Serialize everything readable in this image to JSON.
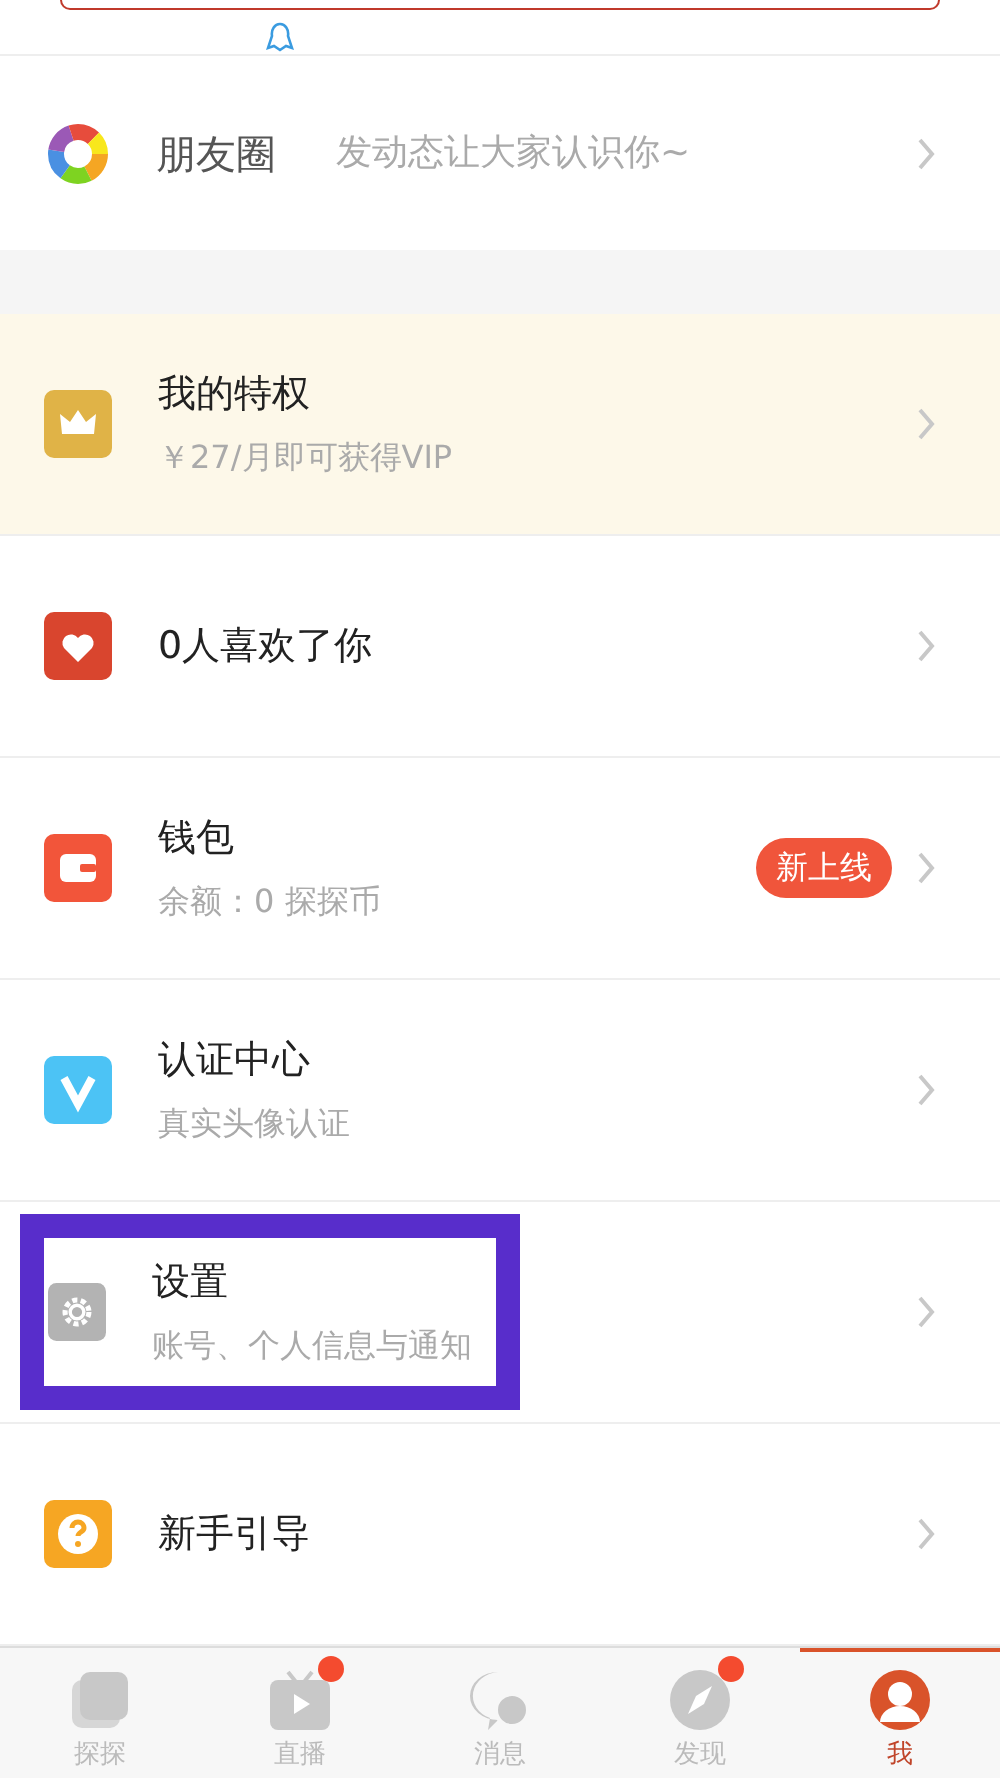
{
  "moments": {
    "title": "朋友圈",
    "hint": "发动态让大家认识你~"
  },
  "items": [
    {
      "kind": "promo",
      "title": "我的特权",
      "subtitle": "￥27/月即可获得VIP",
      "annotated": false
    },
    {
      "kind": "normal",
      "title": "0人喜欢了你",
      "annotated": false
    },
    {
      "kind": "normal",
      "title": "钱包",
      "subtitle": "余额：0 探探币",
      "badge": "新上线",
      "annotated": false
    },
    {
      "kind": "normal",
      "title": "认证中心",
      "subtitle": "真实头像认证",
      "annotated": false
    },
    {
      "kind": "normal",
      "title": "设置",
      "subtitle": "账号、个人信息与通知",
      "annotated": true
    },
    {
      "kind": "normal",
      "title": "新手引导",
      "annotated": false
    }
  ],
  "tabs": [
    {
      "label": "探探",
      "selected": false,
      "dot": false
    },
    {
      "label": "直播",
      "selected": false,
      "dot": true
    },
    {
      "label": "消息",
      "selected": false,
      "dot": false
    },
    {
      "label": "发现",
      "selected": false,
      "dot": true
    },
    {
      "label": "我",
      "selected": true,
      "dot": false
    }
  ]
}
